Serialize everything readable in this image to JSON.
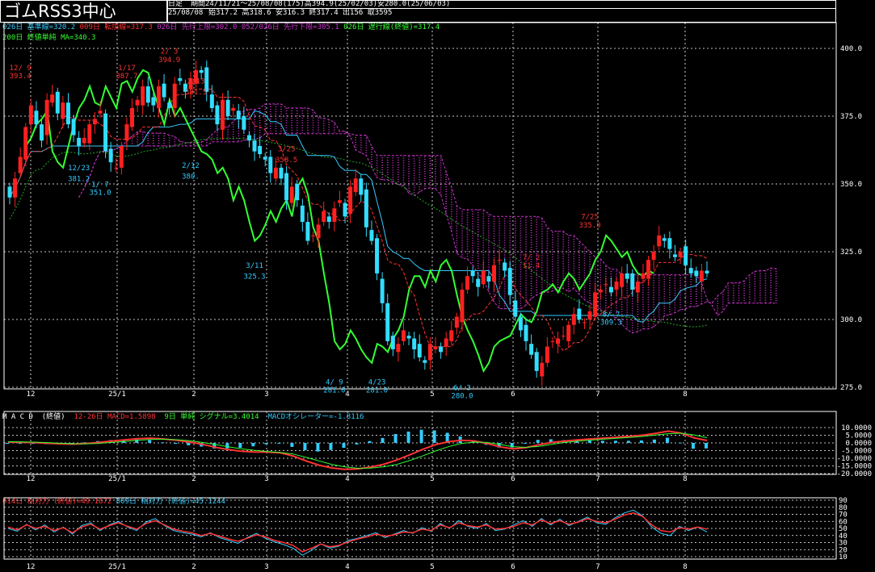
{
  "header": {
    "title": "ゴムRSS3中心",
    "period_type": "日足",
    "period": "期間24/11/21〜25/08/08(175)高394.9(25/02/03)安280.0(25/06/03)",
    "date": "25/08/08",
    "ohlc": "始317.2 高318.6 安316.3 終317.4 出156 取3595"
  },
  "legends": {
    "main_line1": [
      {
        "text": "026日 基準線=320.2",
        "color": "#33ccff"
      },
      {
        "text": "009日 転換線=317.3",
        "color": "#ff3333"
      },
      {
        "text": "026日 先行上限=302.0",
        "color": "#cc33cc"
      },
      {
        "text": "052/026日 先行下限=305.1",
        "color": "#cc33cc"
      },
      {
        "text": "026日 遅行線(終値)=317.4",
        "color": "#33ff33"
      }
    ],
    "main_line2": [
      {
        "text": "200日 終値単純 MA=340.3",
        "color": "#33ff33"
      }
    ],
    "macd": [
      {
        "text": "M A C D  (終値)",
        "color": "#ffffff"
      },
      {
        "text": "12-26日 MACD=1.5898",
        "color": "#ff3333"
      },
      {
        "text": "9日 単純 シグナル=3.4014",
        "color": "#33ff33"
      },
      {
        "text": "MACDオシレーター=-1.8116",
        "color": "#33ccff"
      }
    ],
    "rsi": [
      {
        "text": "014日 相対力 (終値)=49.1672",
        "color": "#ff3333"
      },
      {
        "text": "009日 相対力 (終値)=45.1244",
        "color": "#33ccff"
      }
    ]
  },
  "colors": {
    "up": "#ff2020",
    "down": "#33ddff",
    "kijun": "#33ccff",
    "tenkan": "#ff3333",
    "cloud": "#cc33cc",
    "chikou": "#33ff33",
    "ma200": "#22aa22",
    "grid": "#ffffff"
  },
  "chart_data": [
    {
      "type": "candlestick",
      "title": "ゴムRSS3中心",
      "yticks": [
        "400.0",
        "375.0",
        "350.0",
        "325.0",
        "300.0",
        "275.0"
      ],
      "ylim": [
        275,
        402
      ],
      "x_ticks": [
        "12",
        "25/1",
        "2",
        "3",
        "4",
        "5",
        "6",
        "7",
        "8"
      ],
      "close": [
        345,
        352,
        360,
        371,
        379,
        372,
        366,
        381,
        383,
        376,
        380,
        372,
        368,
        364,
        367,
        372,
        374,
        377,
        362,
        358,
        356,
        364,
        372,
        378,
        381,
        386,
        380,
        379,
        386,
        382,
        378,
        387,
        388,
        384,
        389,
        392,
        391,
        384,
        378,
        372,
        381,
        375,
        378,
        374,
        370,
        366,
        362,
        361,
        359,
        354,
        356,
        352,
        344,
        349,
        344,
        336,
        329,
        331,
        335,
        340,
        336,
        341,
        344,
        338,
        349,
        352,
        346,
        334,
        329,
        317,
        306,
        292,
        289,
        291,
        296,
        293,
        289,
        286,
        284,
        291,
        290,
        288,
        293,
        296,
        301,
        311,
        316,
        316,
        312,
        318,
        314,
        320,
        322,
        318,
        309,
        301,
        296,
        292,
        287,
        281,
        284,
        290,
        292,
        293,
        294,
        298,
        302,
        300,
        299,
        303,
        310,
        311,
        313,
        310,
        314,
        317,
        315,
        311,
        314,
        317,
        322,
        325,
        331,
        329,
        326,
        323,
        325,
        320,
        317,
        316,
        318,
        317
      ],
      "annotations": [
        {
          "text": "12/ 9",
          "i": 2,
          "v": 392,
          "color": "#ff3333"
        },
        {
          "text": "393.4",
          "i": 2,
          "v": 389,
          "color": "#ff3333"
        },
        {
          "text": "12/23",
          "i": 13,
          "v": 355,
          "color": "#33ccff"
        },
        {
          "text": "381.2",
          "i": 13,
          "v": 351,
          "color": "#33ccff"
        },
        {
          "text": "1/17",
          "i": 22,
          "v": 392,
          "color": "#ff3333"
        },
        {
          "text": "387.7",
          "i": 22,
          "v": 389,
          "color": "#ff3333"
        },
        {
          "text": "2/ 3",
          "i": 30,
          "v": 398,
          "color": "#ff3333"
        },
        {
          "text": "394.9",
          "i": 30,
          "v": 395,
          "color": "#ff3333"
        },
        {
          "text": "1/ 7",
          "i": 17,
          "v": 349,
          "color": "#33ccff"
        },
        {
          "text": "351.0",
          "i": 17,
          "v": 346,
          "color": "#33ccff"
        },
        {
          "text": "2/13",
          "i": 35,
          "v": 387,
          "color": "#ff3333"
        },
        {
          "text": "381.5",
          "i": 35,
          "v": 383,
          "color": "#ff3333"
        },
        {
          "text": "2/12",
          "i": 34,
          "v": 356,
          "color": "#33ccff"
        },
        {
          "text": "380.",
          "i": 34,
          "v": 352,
          "color": "#33ccff"
        },
        {
          "text": "3/25",
          "i": 52,
          "v": 362,
          "color": "#ff3333"
        },
        {
          "text": "358.5",
          "i": 52,
          "v": 358,
          "color": "#ff3333"
        },
        {
          "text": "3/11",
          "i": 46,
          "v": 319,
          "color": "#33ccff"
        },
        {
          "text": "325.3",
          "i": 46,
          "v": 315,
          "color": "#33ccff"
        },
        {
          "text": "4/ 9",
          "i": 61,
          "v": 276,
          "color": "#33ccff"
        },
        {
          "text": "281.0",
          "i": 61,
          "v": 273,
          "color": "#33ccff"
        },
        {
          "text": "4/23",
          "i": 69,
          "v": 276,
          "color": "#33ccff"
        },
        {
          "text": "281.0",
          "i": 69,
          "v": 273,
          "color": "#33ccff"
        },
        {
          "text": "6/ 3",
          "i": 85,
          "v": 274,
          "color": "#33ccff"
        },
        {
          "text": "280.0",
          "i": 85,
          "v": 271,
          "color": "#33ccff"
        },
        {
          "text": "7/25",
          "i": 109,
          "v": 337,
          "color": "#ff3333"
        },
        {
          "text": "335.0",
          "i": 109,
          "v": 334,
          "color": "#ff3333"
        },
        {
          "text": "8/ 7",
          "i": 113,
          "v": 301,
          "color": "#33ccff"
        },
        {
          "text": "309.3",
          "i": 113,
          "v": 298,
          "color": "#33ccff"
        },
        {
          "text": "7/ 2",
          "i": 98,
          "v": 322,
          "color": "#ff3333"
        },
        {
          "text": "11.4",
          "i": 98,
          "v": 319,
          "color": "#ff3333"
        }
      ]
    },
    {
      "type": "bar",
      "title": "M A C D  (終値)",
      "yticks": [
        "10.0000",
        "5.0000",
        "0.0000",
        "-5.0000",
        "-10.0000",
        "-15.0000",
        "-20.0000"
      ],
      "ylim": [
        -21,
        11
      ],
      "x_ticks": [
        "12",
        "25/1",
        "2",
        "3",
        "4",
        "5",
        "6",
        "7",
        "8"
      ],
      "series": [
        {
          "name": "MACD",
          "values": [
            0.5,
            0.4,
            0.2,
            -0.2,
            -0.6,
            -0.8,
            -0.4,
            0.3,
            1.2,
            2.0,
            2.8,
            3.1,
            2.6,
            1.8,
            0.6,
            -0.9,
            -2.8,
            -4.3,
            -5.4,
            -5.9,
            -6.0,
            -6.4,
            -8.5,
            -11.7,
            -14.5,
            -16.3,
            -17.2,
            -17.0,
            -15.8,
            -14.0,
            -11.2,
            -7.9,
            -4.3,
            -1.2,
            0.8,
            1.7,
            1.3,
            -0.3,
            -2.5,
            -3.9,
            -3.1,
            -1.2,
            0.3,
            1.2,
            2.0,
            2.6,
            3.1,
            3.7,
            4.3,
            5.0,
            6.2,
            7.7,
            6.4,
            3.3,
            1.6
          ]
        },
        {
          "name": "シグナル",
          "values": [
            0.8,
            0.7,
            0.5,
            0.2,
            -0.2,
            -0.5,
            -0.6,
            -0.3,
            0.3,
            1.0,
            1.7,
            2.2,
            2.4,
            2.1,
            1.4,
            0.3,
            -1.0,
            -2.5,
            -3.8,
            -4.8,
            -5.6,
            -6.2,
            -7.2,
            -9.3,
            -11.7,
            -14.0,
            -15.6,
            -16.5,
            -16.4,
            -15.6,
            -14.1,
            -11.6,
            -8.6,
            -5.3,
            -2.5,
            -0.4,
            0.5,
            0.3,
            -1.0,
            -2.4,
            -2.9,
            -2.2,
            -0.9,
            0.3,
            1.1,
            1.8,
            2.4,
            3.0,
            3.6,
            4.2,
            5.1,
            6.0,
            6.3,
            5.2,
            3.4
          ]
        }
      ]
    },
    {
      "type": "line",
      "title": "相対力",
      "yticks": [
        "90",
        "80",
        "70",
        "60",
        "50",
        "40",
        "30",
        "20",
        "10"
      ],
      "ylim": [
        8,
        92
      ],
      "x_ticks": [
        "12",
        "25/1",
        "2",
        "3",
        "4",
        "5",
        "6",
        "7",
        "8"
      ],
      "series": [
        {
          "name": "014日 相対力 (終値)",
          "values": [
            52,
            48,
            55,
            50,
            53,
            47,
            51,
            44,
            52,
            56,
            49,
            54,
            58,
            53,
            49,
            57,
            61,
            55,
            49,
            46,
            44,
            40,
            43,
            39,
            35,
            32,
            36,
            41,
            38,
            33,
            30,
            26,
            17,
            22,
            28,
            24,
            26,
            31,
            35,
            38,
            42,
            39,
            41,
            45,
            44,
            49,
            47,
            55,
            51,
            58,
            54,
            52,
            55,
            49,
            50,
            53,
            58,
            55,
            62,
            57,
            61,
            56,
            59,
            64,
            60,
            58,
            63,
            69,
            72,
            67,
            55,
            47,
            45,
            51,
            49,
            52,
            49
          ]
        },
        {
          "name": "009日 相対力 (終値)",
          "values": [
            50,
            46,
            56,
            48,
            55,
            45,
            52,
            42,
            54,
            58,
            47,
            55,
            60,
            52,
            47,
            59,
            64,
            54,
            47,
            44,
            42,
            38,
            44,
            37,
            33,
            29,
            37,
            43,
            36,
            31,
            27,
            22,
            12,
            19,
            28,
            22,
            25,
            33,
            36,
            40,
            44,
            37,
            42,
            47,
            43,
            51,
            46,
            57,
            50,
            61,
            53,
            50,
            57,
            47,
            49,
            55,
            61,
            53,
            64,
            55,
            63,
            54,
            60,
            66,
            58,
            56,
            65,
            72,
            76,
            68,
            52,
            43,
            40,
            53,
            47,
            52,
            45
          ]
        }
      ]
    }
  ]
}
